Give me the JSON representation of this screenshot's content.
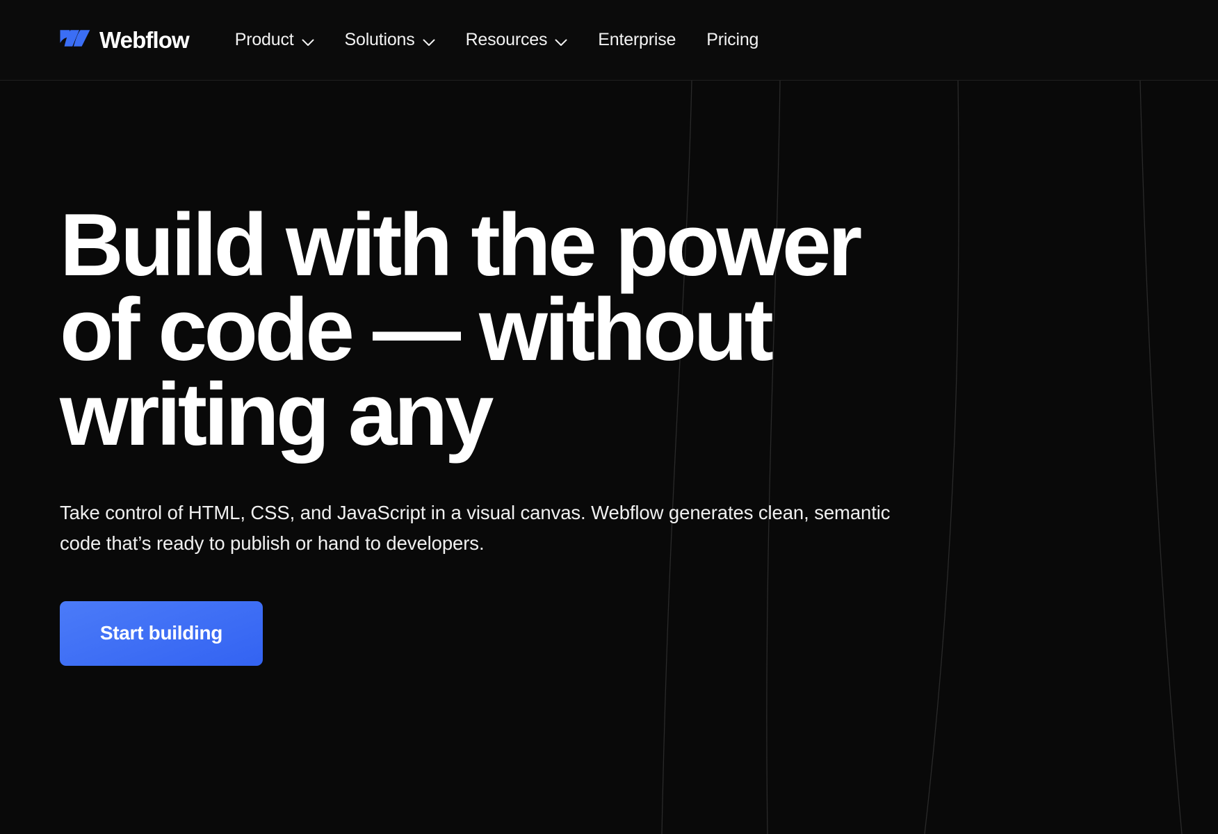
{
  "brand": {
    "name": "Webflow",
    "logo_icon": "webflow-w-mark",
    "logo_color": "#3b6ef5"
  },
  "nav": {
    "items": [
      {
        "label": "Product",
        "has_dropdown": true,
        "caret_icon": "chevron-down-icon"
      },
      {
        "label": "Solutions",
        "has_dropdown": true,
        "caret_icon": "chevron-down-icon"
      },
      {
        "label": "Resources",
        "has_dropdown": true,
        "caret_icon": "chevron-down-icon"
      },
      {
        "label": "Enterprise",
        "has_dropdown": false,
        "caret_icon": ""
      },
      {
        "label": "Pricing",
        "has_dropdown": false,
        "caret_icon": ""
      }
    ]
  },
  "hero": {
    "heading_lines": [
      "Build with the power",
      "of code — without",
      "writing any"
    ],
    "subheading": "Take control of HTML, CSS, and JavaScript in a visual canvas. Webflow generates clean, semantic code that’s ready to publish or hand to developers.",
    "cta_label": "Start building",
    "cta_color": "#3b6ef5"
  },
  "theme": {
    "background": "#090909",
    "header_background": "#0b0b0b",
    "header_border": "#1f1f1f",
    "text_primary": "#ffffff",
    "accent": "#3b6ef5"
  }
}
